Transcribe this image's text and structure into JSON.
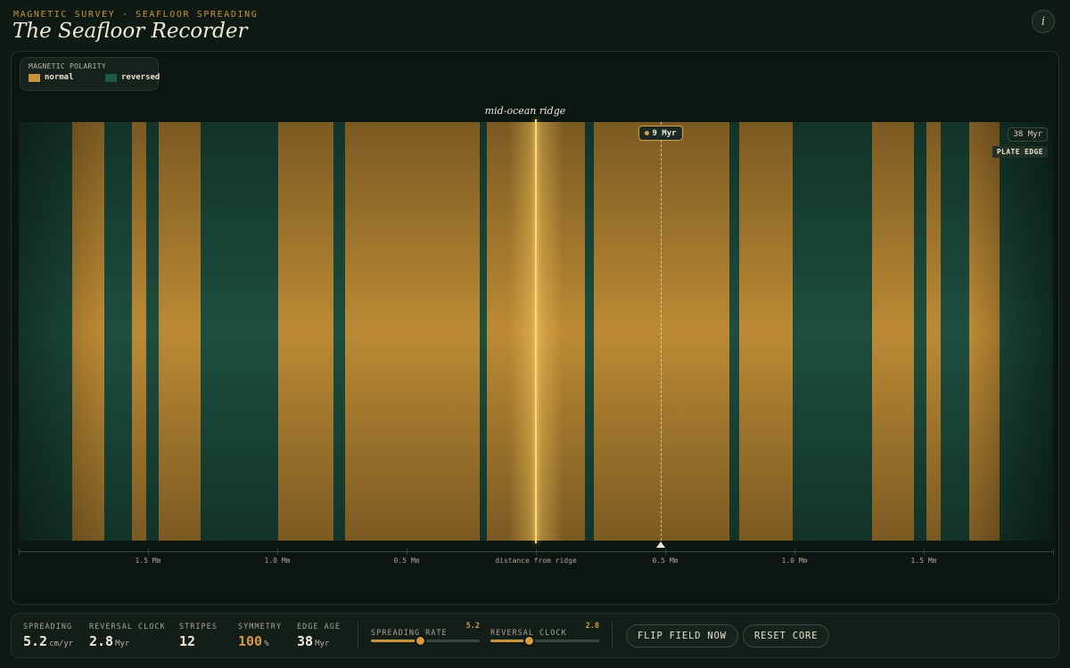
{
  "header": {
    "kicker": "MAGNETIC SURVEY · SEAFLOOR SPREADING",
    "title": "The Seafloor Recorder",
    "info_icon": "i"
  },
  "legend": {
    "title": "MAGNETIC POLARITY",
    "items": [
      {
        "label": "normal",
        "color": "#c8943a"
      },
      {
        "label": "reversed",
        "color": "#1e5a48"
      }
    ]
  },
  "visual": {
    "ridge_label": "mid-ocean ridge",
    "probe_label": "9 Myr",
    "probe_age_myr": 9,
    "edge_age_label": "38 Myr",
    "plate_edge_label": "PLATE EDGE",
    "axis_center_label": "distance from ridge",
    "axis_labels_left": [
      "1.5 Mm",
      "1.0 Mm",
      "0.5 Mm"
    ],
    "axis_labels_right": [
      "0.5 Mm",
      "1.0 Mm",
      "1.5 Mm"
    ]
  },
  "stats": [
    {
      "label": "SPREADING",
      "value": "5.2",
      "unit": "cm/yr"
    },
    {
      "label": "REVERSAL CLOCK",
      "value": "2.8",
      "unit": "Myr"
    },
    {
      "label": "STRIPES",
      "value": "12",
      "unit": ""
    },
    {
      "label": "SYMMETRY",
      "value": "100",
      "unit": "%"
    },
    {
      "label": "EDGE AGE",
      "value": "38",
      "unit": "Myr"
    }
  ],
  "sliders": [
    {
      "label": "SPREADING RATE",
      "value": "5.2",
      "fraction": 0.45
    },
    {
      "label": "REVERSAL CLOCK",
      "value": "2.8",
      "fraction": 0.35
    }
  ],
  "buttons": {
    "flip": "FLIP FIELD NOW",
    "reset": "RESET CORE"
  },
  "colors": {
    "normal": "#bc8a34",
    "reversed": "#1f5445",
    "accent": "#d49a3c"
  }
}
